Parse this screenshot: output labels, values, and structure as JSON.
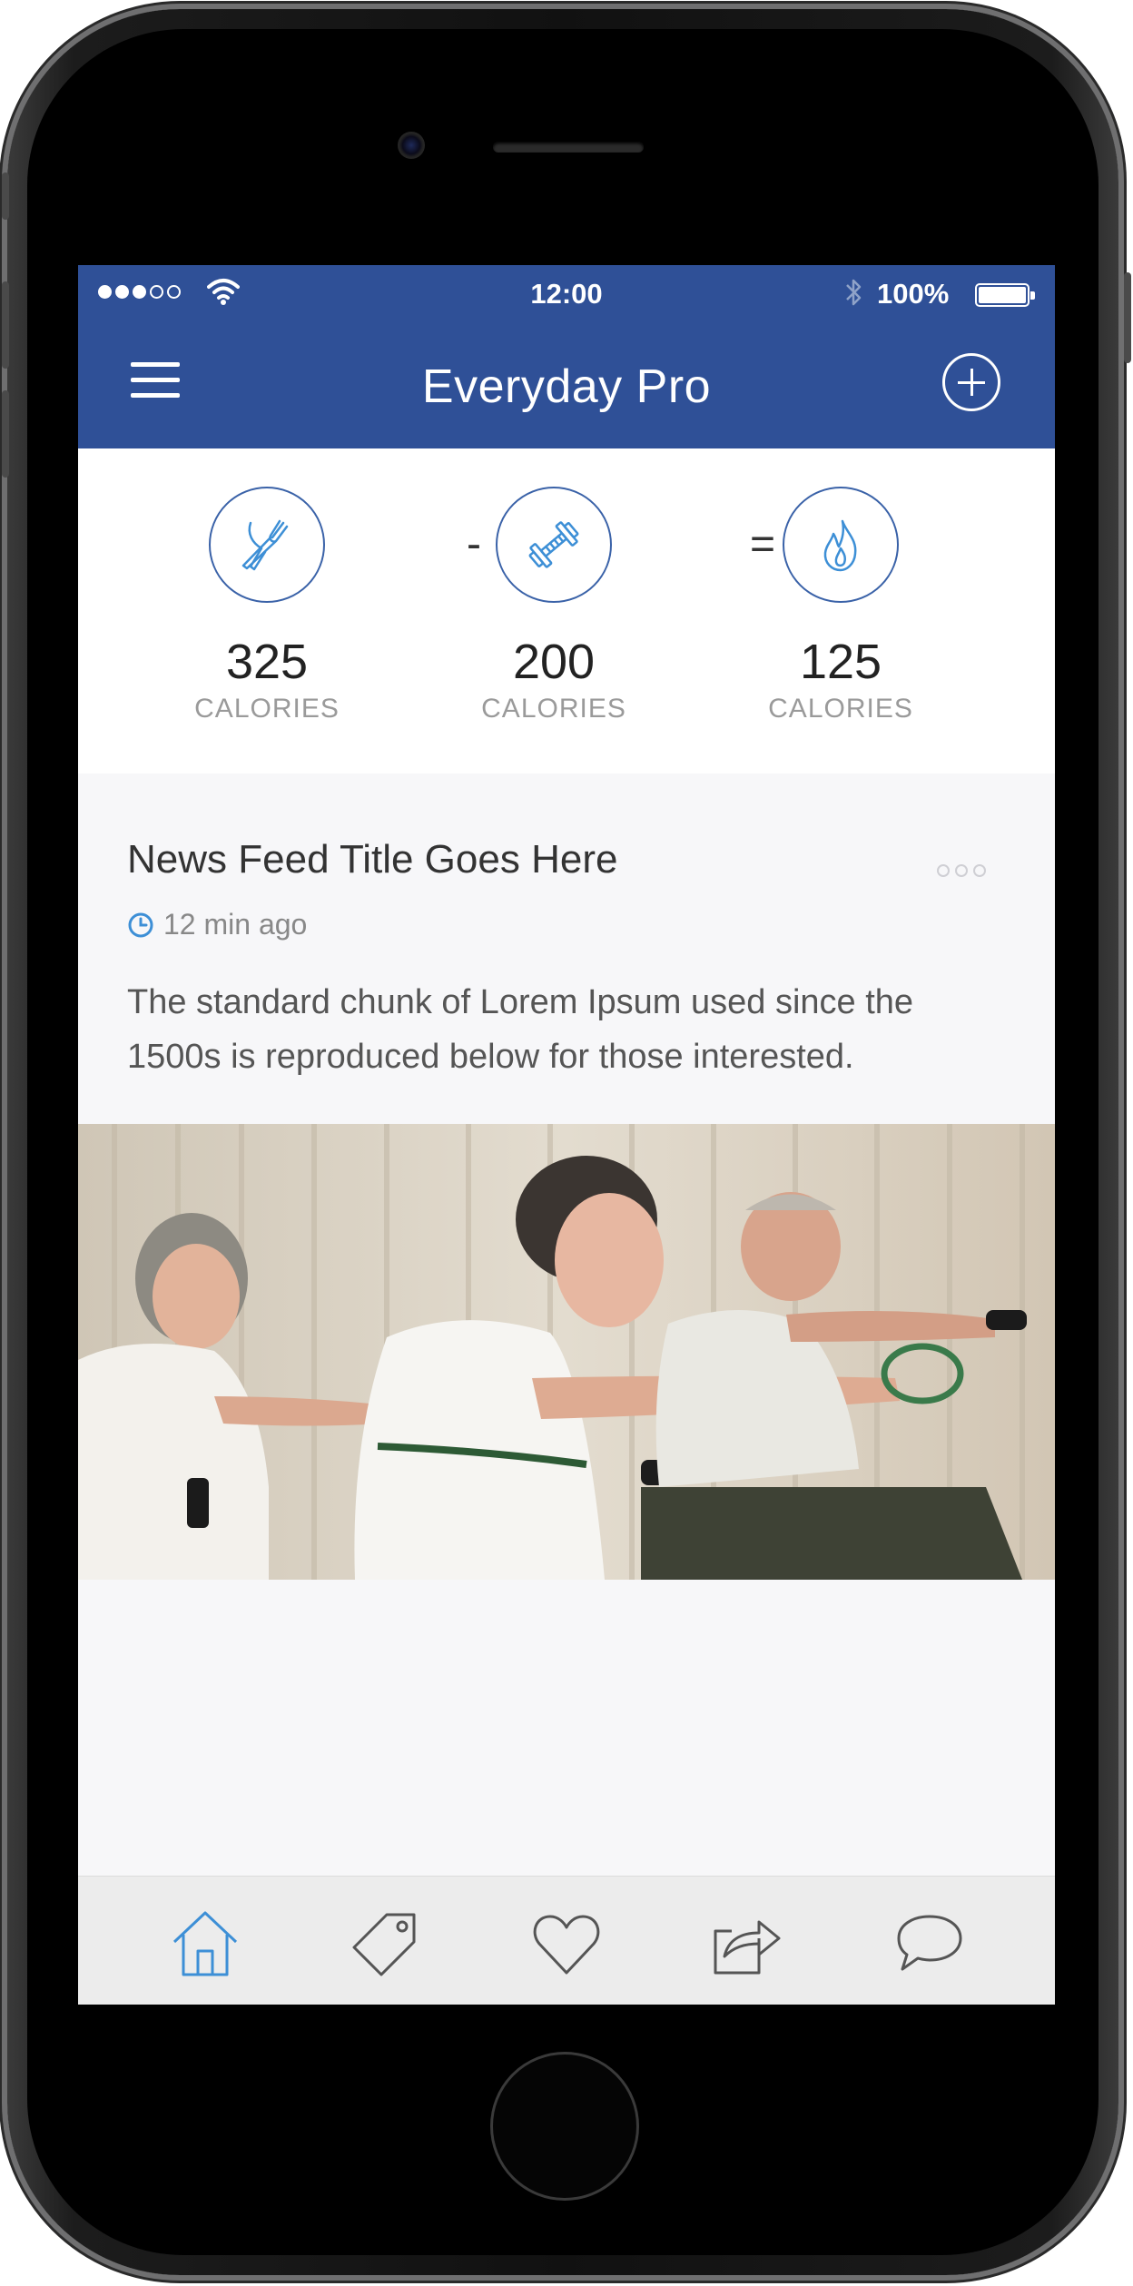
{
  "status_bar": {
    "time": "12:00",
    "battery": "100%",
    "signal_bars": 3,
    "signal_total": 5
  },
  "nav": {
    "title": "Everyday Pro",
    "menu_icon": "hamburger-menu-icon",
    "add_icon": "plus-circle-icon"
  },
  "summary": {
    "stats": [
      {
        "icon": "fork-knife-icon",
        "value": "325",
        "label": "CALORIES"
      },
      {
        "icon": "dumbbell-icon",
        "value": "200",
        "label": "CALORIES"
      },
      {
        "icon": "flame-icon",
        "value": "125",
        "label": "CALORIES"
      }
    ],
    "minus": "-",
    "equals": "="
  },
  "news": {
    "title": "News Feed Title Goes Here",
    "time_ago": "12 min ago",
    "body": "The standard chunk of Lorem Ipsum used since the 1500s is reproduced below for those interested."
  },
  "tabs": [
    {
      "icon": "home-icon",
      "active": true
    },
    {
      "icon": "tag-icon",
      "active": false
    },
    {
      "icon": "heart-icon",
      "active": false
    },
    {
      "icon": "share-icon",
      "active": false
    },
    {
      "icon": "chat-bubble-icon",
      "active": false
    }
  ],
  "colors": {
    "primary": "#2f5097",
    "accent": "#3d8fd6",
    "icon_gray": "#555555"
  }
}
